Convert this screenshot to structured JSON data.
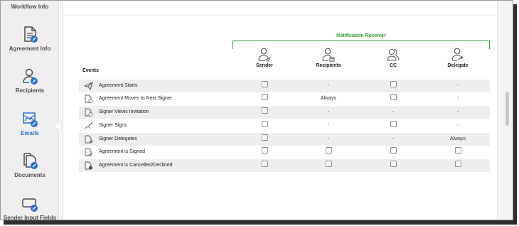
{
  "sidebar": {
    "items": [
      {
        "label": "Workflow Info",
        "icon": "workflow-icon"
      },
      {
        "label": "Agreement Info",
        "icon": "agreement-info-icon"
      },
      {
        "label": "Recipients",
        "icon": "recipients-icon"
      },
      {
        "label": "Emails",
        "icon": "emails-icon",
        "active": true
      },
      {
        "label": "Documents",
        "icon": "documents-icon"
      },
      {
        "label": "Sender Input Fields",
        "icon": "sender-input-fields-icon"
      }
    ]
  },
  "table": {
    "group_title": "Notification Receiver",
    "events_header": "Events",
    "columns": [
      "Sender",
      "Recipients",
      "CC",
      "Delegate"
    ],
    "rows": [
      {
        "event": "Agreement Starts",
        "icon": "send-icon",
        "cells": [
          "checkbox",
          "-",
          "checkbox",
          "-"
        ]
      },
      {
        "event": "Agreement Moves to Next Signer",
        "icon": "doc-next-icon",
        "cells": [
          "checkbox",
          "Always",
          "checkbox",
          "-"
        ]
      },
      {
        "event": "Signer Views Invitation",
        "icon": "doc-view-icon",
        "cells": [
          "checkbox",
          "-",
          "-",
          "-"
        ]
      },
      {
        "event": "Signer Signs",
        "icon": "sign-pen-icon",
        "cells": [
          "checkbox",
          "-",
          "checkbox",
          "-"
        ]
      },
      {
        "event": "Signer Delegates",
        "icon": "doc-delegate-icon",
        "cells": [
          "checkbox",
          "-",
          "-",
          "Always"
        ]
      },
      {
        "event": "Agreement is Signed",
        "icon": "doc-signed-icon",
        "cells": [
          "checkbox",
          "checkbox",
          "checkbox",
          "checkbox"
        ]
      },
      {
        "event": "Agreement is Cancelled/Declined",
        "icon": "doc-cancelled-icon",
        "cells": [
          "checkbox",
          "checkbox",
          "checkbox",
          "checkbox"
        ]
      }
    ]
  },
  "colors": {
    "accent": "#2c6fd6",
    "group": "#2f9a2f",
    "row_shade": "#eeeeee"
  }
}
